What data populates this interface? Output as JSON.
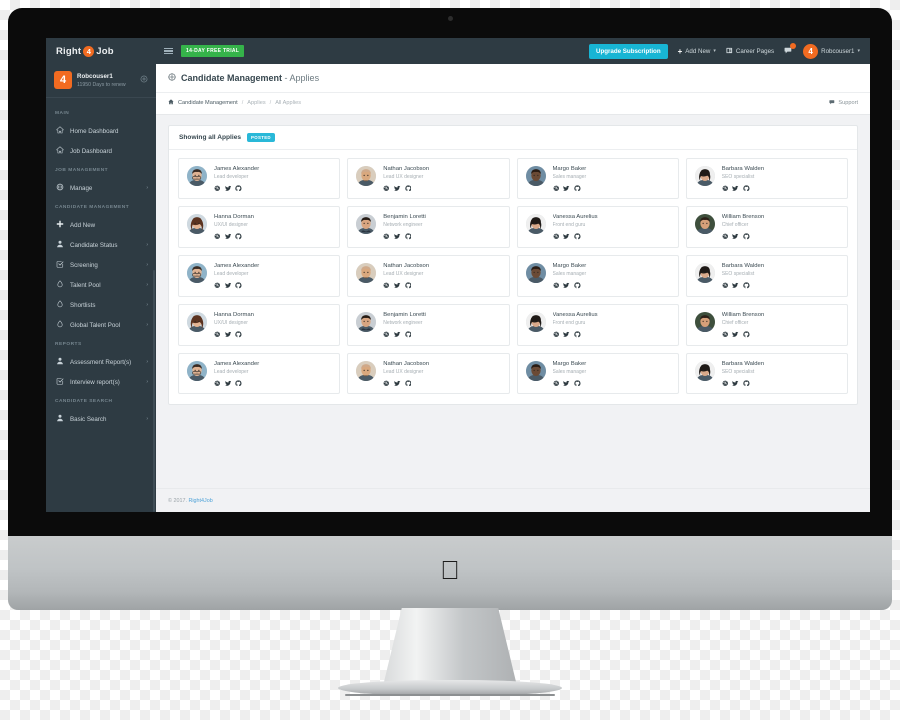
{
  "brand": {
    "part1": "Right",
    "badge": "4",
    "part2": "Job"
  },
  "topbar": {
    "menu_icon": "hamburger-icon",
    "trial_badge": "14-DAY FREE TRIAL",
    "upgrade_label": "Upgrade Subscription",
    "add_new_label": "Add New",
    "career_pages_label": "Career Pages",
    "chat_icon": "chat-icon",
    "notification_dot": true,
    "avatar_initial": "4",
    "user_label": "Robcouser1",
    "caret": "▾"
  },
  "sidebar": {
    "user": {
      "avatar_initial": "4",
      "name": "Robcouser1",
      "subtitle": "11950 Days to renew",
      "settings_icon": "gear-icon"
    },
    "groups": [
      {
        "title": "MAIN",
        "items": [
          {
            "label": "Home Dashboard",
            "icon": "home-icon",
            "arrow": false
          },
          {
            "label": "Job Dashboard",
            "icon": "home-icon",
            "arrow": false
          }
        ]
      },
      {
        "title": "JOB MANAGEMENT",
        "items": [
          {
            "label": "Manage",
            "icon": "globe-icon",
            "arrow": true
          }
        ]
      },
      {
        "title": "CANDIDATE MANAGEMENT",
        "items": [
          {
            "label": "Add New",
            "icon": "plus-icon",
            "arrow": false
          },
          {
            "label": "Candidate Status",
            "icon": "user-icon",
            "arrow": true
          },
          {
            "label": "Screening",
            "icon": "check-square-icon",
            "arrow": true
          },
          {
            "label": "Talent Pool",
            "icon": "droplet-icon",
            "arrow": true
          },
          {
            "label": "Shortlists",
            "icon": "droplet-icon",
            "arrow": true
          },
          {
            "label": "Global Talent Pool",
            "icon": "droplet-icon",
            "arrow": true
          }
        ]
      },
      {
        "title": "REPORTS",
        "items": [
          {
            "label": "Assessment Report(s)",
            "icon": "user-icon",
            "arrow": true
          },
          {
            "label": "Interview report(s)",
            "icon": "check-square-icon",
            "arrow": true
          }
        ]
      },
      {
        "title": "CANDIDATE SEARCH",
        "items": [
          {
            "label": "Basic Search",
            "icon": "user-icon",
            "arrow": true
          }
        ]
      }
    ]
  },
  "page": {
    "head_icon": "target-icon",
    "title_strong": "Candidate Management",
    "title_rest": "- Applies"
  },
  "breadcrumb": {
    "home_icon": "home-icon",
    "item1": "Candidate Management",
    "sep": "/",
    "item2": "Applies",
    "item3": "All Applies",
    "support_label": "Support",
    "support_icon": "chat-icon"
  },
  "panel": {
    "title": "Showing all Applies",
    "badge": "POSTED"
  },
  "cards": [
    {
      "name": "James Alexander",
      "role": "Lead developer",
      "avatar": "male-glasses",
      "socials": [
        "dribbble-icon",
        "twitter-icon",
        "github-icon"
      ]
    },
    {
      "name": "Nathan Jacobson",
      "role": "Lead UX designer",
      "avatar": "male-bald",
      "socials": [
        "dribbble-icon",
        "twitter-icon",
        "github-icon"
      ]
    },
    {
      "name": "Margo Baker",
      "role": "Sales manager",
      "avatar": "male-dark",
      "socials": [
        "dribbble-icon",
        "twitter-icon",
        "github-icon"
      ]
    },
    {
      "name": "Barbara Walden",
      "role": "SEO specialist",
      "avatar": "female-dark",
      "socials": [
        "dribbble-icon",
        "twitter-icon",
        "github-icon"
      ]
    },
    {
      "name": "Hanna Dorman",
      "role": "UX/UI designer",
      "avatar": "female-brown",
      "socials": [
        "dribbble-icon",
        "twitter-icon",
        "github-icon"
      ]
    },
    {
      "name": "Benjamin Loretti",
      "role": "Network engineer",
      "avatar": "male-suit",
      "socials": [
        "dribbble-icon",
        "twitter-icon",
        "github-icon"
      ]
    },
    {
      "name": "Vanessa Aurelius",
      "role": "Front end guru",
      "avatar": "female-dark",
      "socials": [
        "dribbble-icon",
        "twitter-icon",
        "github-icon"
      ]
    },
    {
      "name": "William Brenson",
      "role": "Chief officer",
      "avatar": "male-green",
      "socials": [
        "dribbble-icon",
        "twitter-icon",
        "github-icon"
      ]
    },
    {
      "name": "James Alexander",
      "role": "Lead developer",
      "avatar": "male-glasses",
      "socials": [
        "dribbble-icon",
        "twitter-icon",
        "github-icon"
      ]
    },
    {
      "name": "Nathan Jacobson",
      "role": "Lead UX designer",
      "avatar": "male-bald",
      "socials": [
        "dribbble-icon",
        "twitter-icon",
        "github-icon"
      ]
    },
    {
      "name": "Margo Baker",
      "role": "Sales manager",
      "avatar": "male-dark",
      "socials": [
        "dribbble-icon",
        "twitter-icon",
        "github-icon"
      ]
    },
    {
      "name": "Barbara Walden",
      "role": "SEO specialist",
      "avatar": "female-dark",
      "socials": [
        "dribbble-icon",
        "twitter-icon",
        "github-icon"
      ]
    },
    {
      "name": "Hanna Dorman",
      "role": "UX/UI designer",
      "avatar": "female-brown",
      "socials": [
        "dribbble-icon",
        "twitter-icon",
        "github-icon"
      ]
    },
    {
      "name": "Benjamin Loretti",
      "role": "Network engineer",
      "avatar": "male-suit",
      "socials": [
        "dribbble-icon",
        "twitter-icon",
        "github-icon"
      ]
    },
    {
      "name": "Vanessa Aurelius",
      "role": "Front end guru",
      "avatar": "female-dark",
      "socials": [
        "dribbble-icon",
        "twitter-icon",
        "github-icon"
      ]
    },
    {
      "name": "William Brenson",
      "role": "Chief officer",
      "avatar": "male-green",
      "socials": [
        "dribbble-icon",
        "twitter-icon",
        "github-icon"
      ]
    },
    {
      "name": "James Alexander",
      "role": "Lead developer",
      "avatar": "male-glasses",
      "socials": [
        "dribbble-icon",
        "twitter-icon",
        "github-icon"
      ]
    },
    {
      "name": "Nathan Jacobson",
      "role": "Lead UX designer",
      "avatar": "male-bald",
      "socials": [
        "dribbble-icon",
        "twitter-icon",
        "github-icon"
      ]
    },
    {
      "name": "Margo Baker",
      "role": "Sales manager",
      "avatar": "male-dark",
      "socials": [
        "dribbble-icon",
        "twitter-icon",
        "github-icon"
      ]
    },
    {
      "name": "Barbara Walden",
      "role": "SEO specialist",
      "avatar": "female-dark",
      "socials": [
        "dribbble-icon",
        "twitter-icon",
        "github-icon"
      ]
    }
  ],
  "footer": {
    "copyright": "© 2017.",
    "link": "Right4Job"
  },
  "colors": {
    "sidebar": "#2e3b43",
    "brand_orange": "#f26b21",
    "accent_cyan": "#18b5d4",
    "trial_green": "#35b34a",
    "posted_cyan": "#29b8d8",
    "link_blue": "#4fa3d8"
  },
  "device": {
    "logo": "apple-logo"
  }
}
